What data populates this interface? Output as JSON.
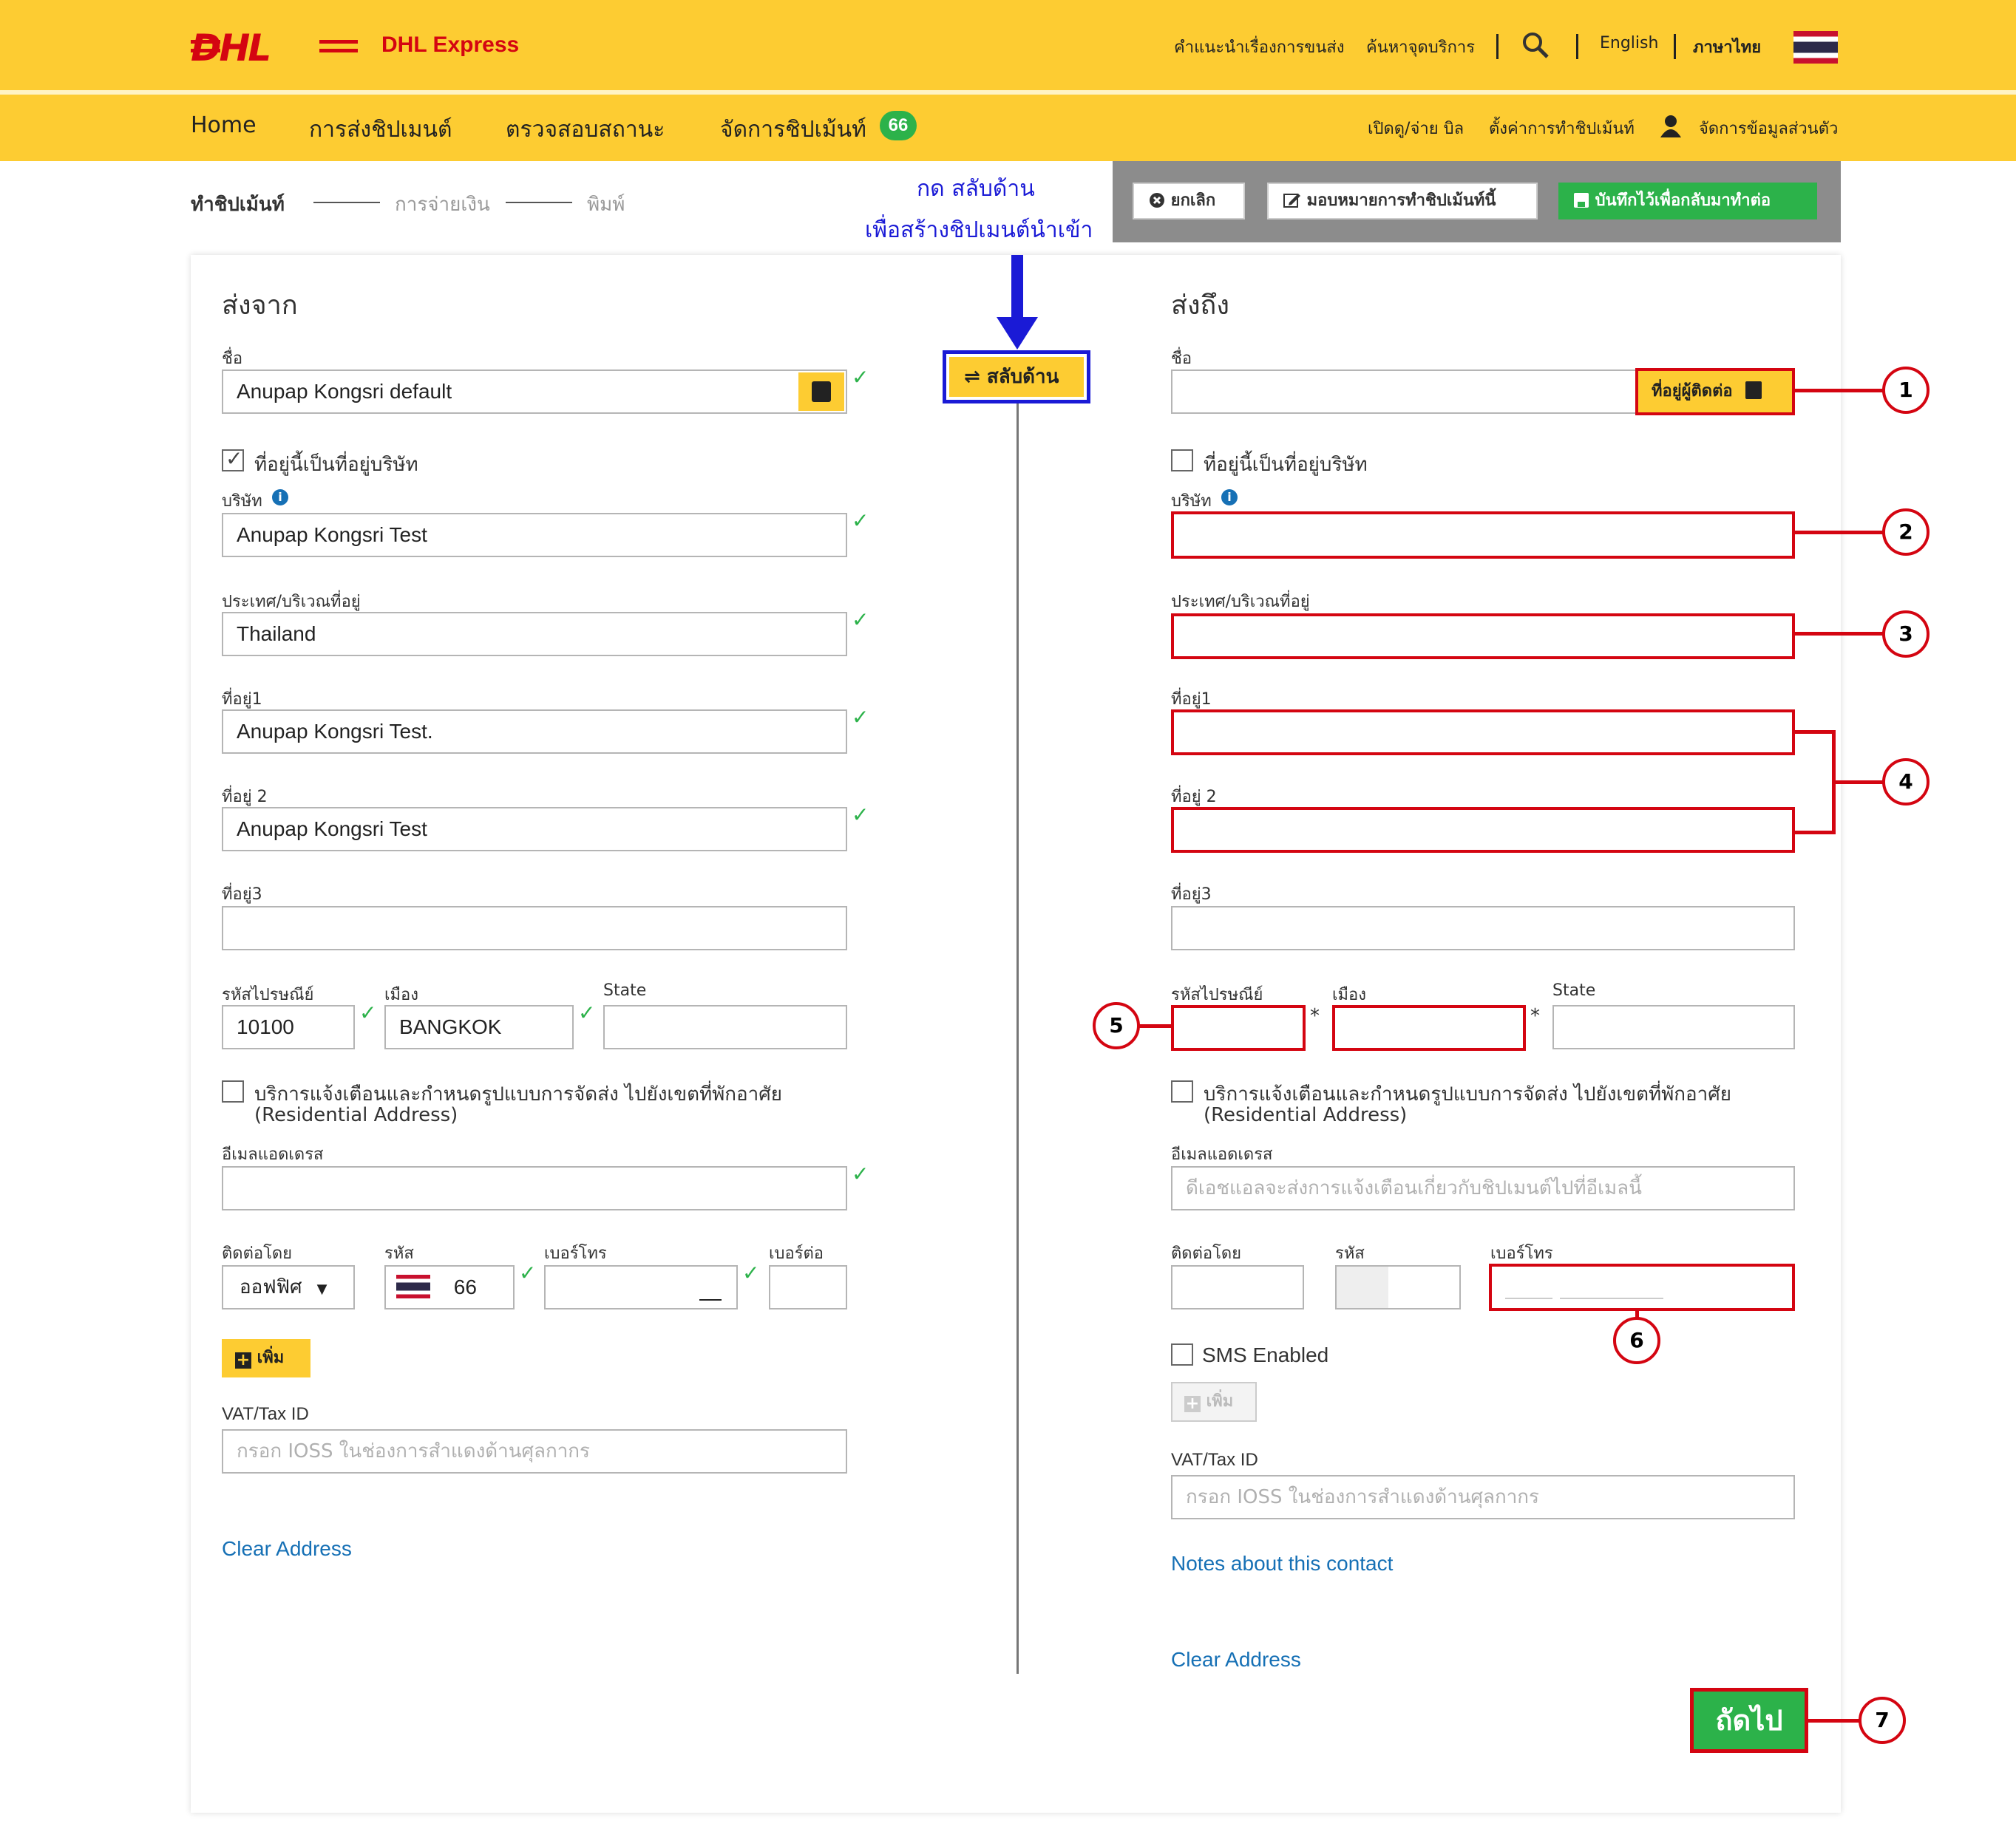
{
  "header": {
    "brand": "DHL Express",
    "logo_word": "DHL",
    "top_links": [
      "คำแนะนำเรื่องการขนส่ง",
      "ค้นหาจุดบริการ"
    ],
    "search_icon": "search-icon",
    "lang_english": "English",
    "lang_thai": "ภาษาไทย",
    "nav": [
      "Home",
      "การส่งชิปเมนต์",
      "ตรวจสอบสถานะ",
      "จัดการชิปเม้นท์"
    ],
    "nav_badge": "66",
    "nav_right": [
      "เปิดดู/จ่าย บิล",
      "ตั้งค่าการทำชิปเม้นท์",
      "จัดการข้อมูลส่วนตัว"
    ]
  },
  "steps": [
    "ทำชิปเม้นท์",
    "การจ่ายเงิน",
    "พิมพ์"
  ],
  "actions": {
    "cancel": "ยกเลิก",
    "assign": "มอบหมายการทำชิปเม้นท์นี้",
    "save": "บันทึกไว้เพื่อกลับมาทำต่อ"
  },
  "annotation": {
    "line1": "กด สลับด้าน",
    "line2": "เพื่อสร้างชิปเมนต์นำเข้า",
    "swap_button": "สลับด้าน"
  },
  "from": {
    "title": "ส่งจาก",
    "name_label": "ชื่อ",
    "name_value": "Anupap Kongsri default",
    "is_company_label": "ที่อยู่นี้เป็นที่อยู่บริษัท",
    "is_company_checked": true,
    "company_label": "บริษัท",
    "company_value": "Anupap Kongsri Test",
    "country_label": "ประเทศ/บริเวณที่อยู่",
    "country_value": "Thailand",
    "addr1_label": "ที่อยู่1",
    "addr1_value": "Anupap Kongsri Test.",
    "addr2_label": "ที่อยู่ 2",
    "addr2_value": "Anupap Kongsri Test",
    "addr3_label": "ที่อยู่3",
    "addr3_value": "",
    "postcode_label": "รหัสไปรษณีย์",
    "postcode_value": "10100",
    "city_label": "เมือง",
    "city_value": "BANGKOK",
    "state_label": "State",
    "state_value": "",
    "residential_label": "บริการแจ้งเตือนและกำหนดรูปแบบการจัดส่ง ไปยังเขตที่พักอาศัย",
    "residential_sub": "(Residential Address)",
    "email_label": "อีเมลแอดเดรส",
    "email_value": "",
    "contact_label": "ติดต่อโดย",
    "contact_value": "ออฟฟิศ",
    "code_label": "รหัส",
    "code_value": "66",
    "phone_label": "เบอร์โทร",
    "ext_label": "เบอร์ต่อ",
    "add_label": "เพิ่ม",
    "vat_label": "VAT/Tax ID",
    "vat_placeholder": "กรอก IOSS ในช่องการสำแดงด้านศุลกากร",
    "clear": "Clear Address"
  },
  "to": {
    "title": "ส่งถึง",
    "name_label": "ชื่อ",
    "address_book": "ที่อยู่ผู้ติดต่อ",
    "is_company_label": "ที่อยู่นี้เป็นที่อยู่บริษัท",
    "is_company_checked": false,
    "company_label": "บริษัท",
    "country_label": "ประเทศ/บริเวณที่อยู่",
    "addr1_label": "ที่อยู่1",
    "addr2_label": "ที่อยู่ 2",
    "addr3_label": "ที่อยู่3",
    "postcode_label": "รหัสไปรษณีย์",
    "city_label": "เมือง",
    "state_label": "State",
    "required_mark": "*",
    "residential_label": "บริการแจ้งเตือนและกำหนดรูปแบบการจัดส่ง ไปยังเขตที่พักอาศัย",
    "residential_sub": "(Residential Address)",
    "email_label": "อีเมลแอดเดรส",
    "email_placeholder": "ดีเอชแอลจะส่งการแจ้งเตือนเกี่ยวกับชิปเมนต์ไปที่อีเมลนี้",
    "contact_label": "ติดต่อโดย",
    "code_label": "รหัส",
    "phone_label": "เบอร์โทร",
    "sms_label": "SMS Enabled",
    "add_label": "เพิ่ม",
    "vat_label": "VAT/Tax ID",
    "vat_placeholder": "กรอก IOSS ในช่องการสำแดงด้านศุลกากร",
    "notes": "Notes about this contact",
    "clear": "Clear Address"
  },
  "next_button": "ถัดไป",
  "callouts": [
    "1",
    "2",
    "3",
    "4",
    "5",
    "6",
    "7"
  ],
  "colors": {
    "dhl_yellow": "#fdcc32",
    "dhl_red": "#d40511",
    "green": "#2cb24a",
    "link": "#1670b5",
    "annotation_blue": "#1a1ad6"
  }
}
